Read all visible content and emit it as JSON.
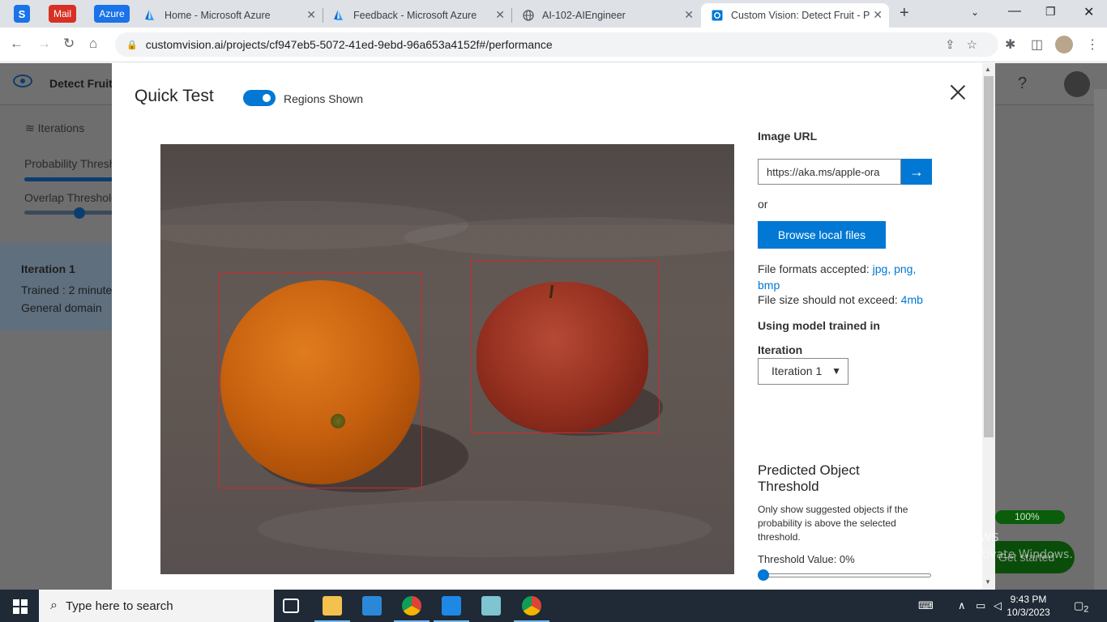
{
  "browser": {
    "pinned": {
      "s": "S",
      "mail": "Mail",
      "azure": "Azure"
    },
    "tabs": [
      {
        "label": "Home - Microsoft Azure"
      },
      {
        "label": "Feedback - Microsoft Azure"
      },
      {
        "label": "AI-102-AIEngineer"
      },
      {
        "label": "Custom Vision: Detect Fruit - P"
      }
    ],
    "url": "customvision.ai/projects/cf947eb5-5072-41ed-9ebd-96a653a4152f#/performance"
  },
  "app": {
    "project_name": "Detect Fruit",
    "help": "?",
    "sidebar": {
      "iterations_label": "Iterations",
      "probability_label": "Probability Thresh",
      "overlap_label": "Overlap Threshold"
    },
    "iteration_card": {
      "title": "Iteration 1",
      "trained": "Trained : 2 minute",
      "domain": "General domain"
    },
    "progress": "100%",
    "get_started": "Get started"
  },
  "modal": {
    "title": "Quick Test",
    "regions_toggle": "Regions Shown",
    "regions_on": true,
    "image_url_label": "Image URL",
    "image_url_value": "https://aka.ms/apple-ora",
    "or": "or",
    "browse_button": "Browse local files",
    "formats_prefix": "File formats accepted:",
    "formats": [
      "jpg,",
      "png,",
      "bmp"
    ],
    "size_prefix": "File size should not exceed:",
    "size_limit": "4mb",
    "model_label": "Using model trained in",
    "iteration_label": "Iteration",
    "iteration_selected": "Iteration 1",
    "threshold_heading": "Predicted Object Threshold",
    "threshold_desc": "Only show suggested objects if the probability is above the selected threshold.",
    "threshold_value": "Threshold Value: 0%",
    "threshold_fraction": 0.0
  },
  "watermark": {
    "line1": "Activate Windows",
    "line2": "Go to Settings to activate Windows."
  },
  "taskbar": {
    "search_placeholder": "Type here to search",
    "time": "9:43 PM",
    "date": "10/3/2023",
    "notification_count": "2"
  },
  "colors": {
    "accent": "#0078d4",
    "bbox": "#d2282c",
    "mail": "#d93025",
    "azure_pin": "#1a73e8"
  }
}
